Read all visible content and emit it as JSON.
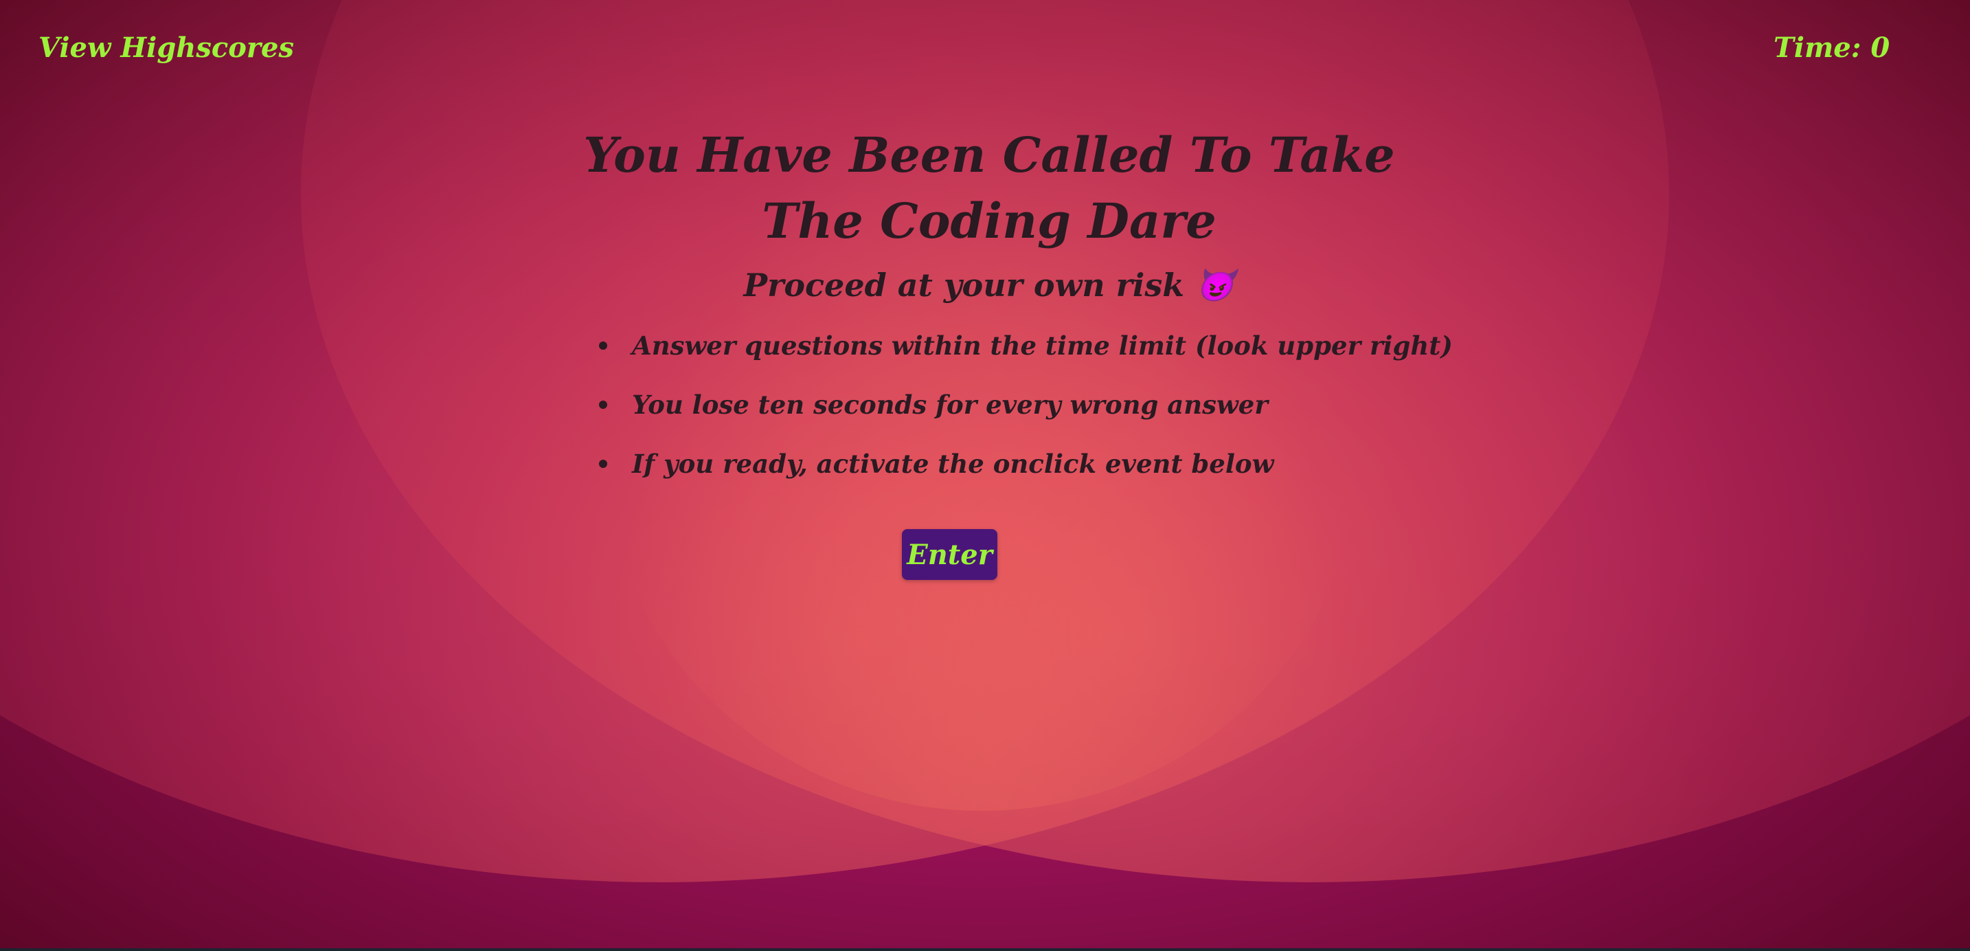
{
  "header": {
    "highscores_link": "View Highscores",
    "timer_text": "Time: 0"
  },
  "intro": {
    "title": "You Have Been Called To Take The Coding Dare",
    "subtitle": "Proceed at your own risk 😈",
    "rules": [
      "Answer questions within the time limit (look upper right)",
      "You lose ten seconds for every wrong answer",
      "If you ready, activate the onclick event below"
    ],
    "enter_label": "Enter"
  },
  "colors": {
    "accent_text": "#9cf23a",
    "body_text": "#2a1a22",
    "button_background": "#4a1578",
    "background_magenta": "#941053",
    "background_glow": "#f26e5c"
  }
}
